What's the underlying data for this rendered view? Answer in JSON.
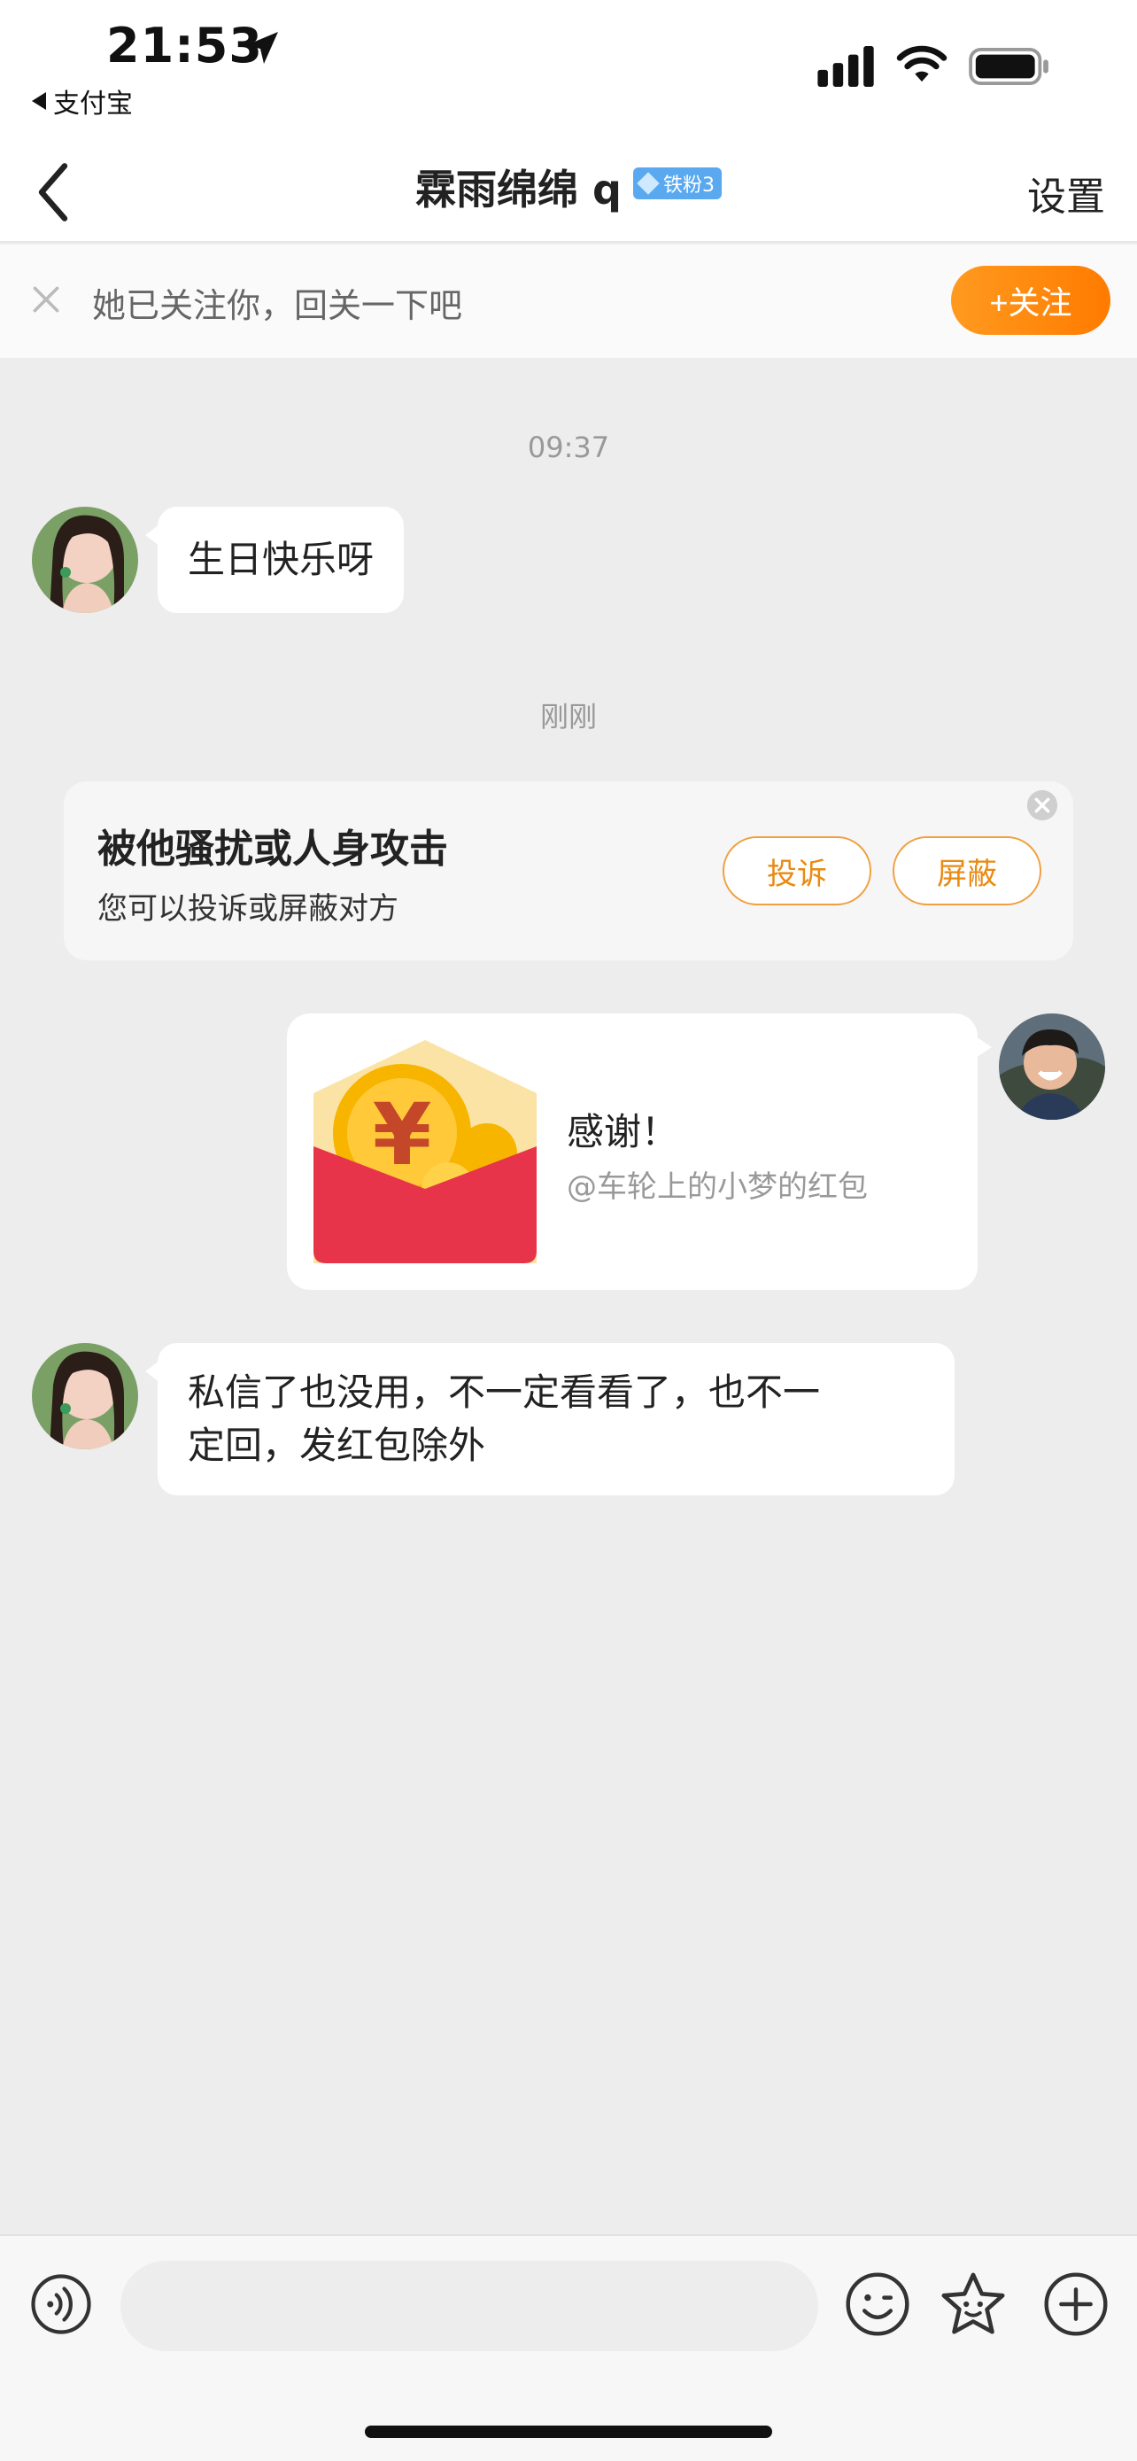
{
  "status_bar": {
    "time": "21:53",
    "back_app": "支付宝",
    "icons": [
      "location-arrow-icon",
      "signal-icon",
      "wifi-icon",
      "battery-icon"
    ]
  },
  "nav": {
    "title": "霖雨绵绵 q",
    "badge": "铁粉3",
    "settings": "设置"
  },
  "follow_banner": {
    "text": "她已关注你，回关一下吧",
    "button": "+关注"
  },
  "chat": {
    "timestamp_1": "09:37",
    "message_1": "生日快乐呀",
    "timestamp_2": "刚刚",
    "safety_tip": {
      "title": "被他骚扰或人身攻击",
      "subtitle": "您可以投诉或屏蔽对方",
      "report_button": "投诉",
      "block_button": "屏蔽"
    },
    "red_packet": {
      "title": "感谢！",
      "subtitle": "@车轮上的小梦的红包"
    },
    "message_2_line1": "私信了也没用，不一定看看了，也不一",
    "message_2_line2": "定回，发红包除外"
  },
  "input_bar": {
    "placeholder": ""
  },
  "colors": {
    "accent_orange": "#ff8a00",
    "chat_background": "#ededed",
    "badge_blue": "#5aa9f0",
    "red_packet": "#e8344a"
  }
}
